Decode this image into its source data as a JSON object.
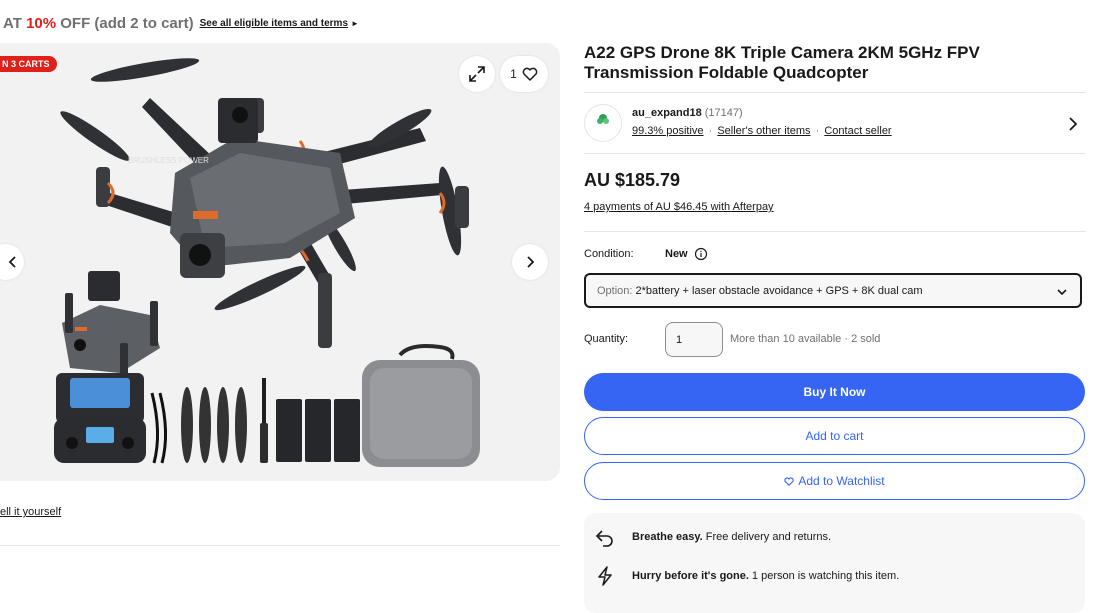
{
  "promo": {
    "prefix": "AT ",
    "highlight": "10%",
    "suffix": " OFF (add 2 to cart)",
    "link": "See all eligible items and terms"
  },
  "gallery": {
    "carts_badge": "N 3 CARTS",
    "watch_count": "1"
  },
  "diy_link": "ell it yourself",
  "product": {
    "title": "A22 GPS Drone 8K Triple Camera 2KM 5GHz FPV Transmission Foldable Quadcopter"
  },
  "seller": {
    "logo_text": "au_expand18",
    "name": "au_expand18",
    "feedback_count": "(17147)",
    "positive": "99.3% positive",
    "other_items": "Seller's other items",
    "contact": "Contact seller"
  },
  "price": {
    "amount": "AU $185.79",
    "afterpay": "4 payments of AU $46.45 with Afterpay"
  },
  "condition": {
    "label": "Condition:",
    "value": "New"
  },
  "option": {
    "prefix": "Option:",
    "value": "2*battery + laser obstacle avoidance + GPS + 8K dual cam"
  },
  "quantity": {
    "label": "Quantity:",
    "value": "1",
    "availability": "More than 10 available · 2 sold"
  },
  "buttons": {
    "buy_now": "Buy It Now",
    "add_to_cart": "Add to cart",
    "watchlist": "Add to Watchlist"
  },
  "info_card": {
    "row1_bold": "Breathe easy.",
    "row1_text": "Free delivery and returns.",
    "row2_bold": "Hurry before it's gone.",
    "row2_text": "1 person is watching this item."
  },
  "colors": {
    "accent": "#3665f3",
    "promo_red": "#e0201b",
    "gallery_bg": "#f2f2f2",
    "text": "#191919",
    "muted": "#707070"
  },
  "icons": [
    "expand-icon",
    "heart-icon",
    "chevron-left-icon",
    "chevron-right-icon",
    "info-icon",
    "chevron-down-icon",
    "return-icon",
    "lightning-icon"
  ]
}
